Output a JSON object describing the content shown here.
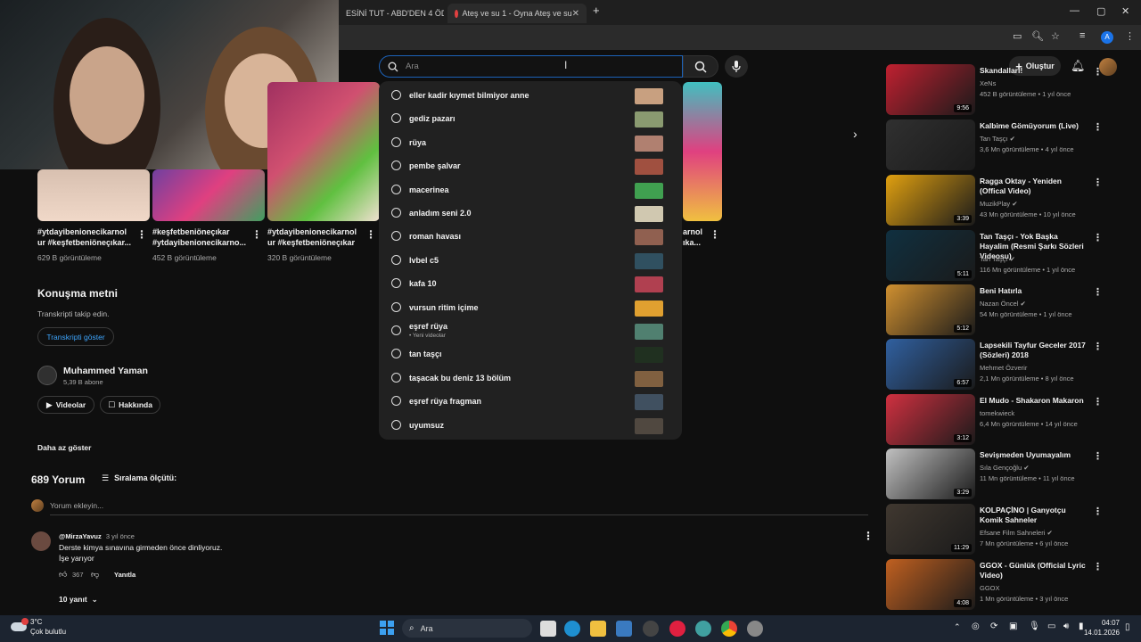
{
  "browser": {
    "tabs": [
      {
        "title": "ESİNİ TUT - ABD'DEN 4 ÖD"
      },
      {
        "title": "Ateş ve su 1 - Oyna Ateş ve su"
      }
    ],
    "new_tab": "+",
    "window_controls": [
      "—",
      "▢",
      "✕"
    ]
  },
  "youtube": {
    "search_placeholder": "Ara",
    "create_label": "Oluştur",
    "suggestions": [
      {
        "text": "eller kadir kıymet bilmiyor anne",
        "color": "#c8a080"
      },
      {
        "text": "gediz pazarı",
        "color": "#8a9a70"
      },
      {
        "text": "rüya",
        "color": "#b08070"
      },
      {
        "text": "pembe şalvar",
        "color": "#a05040"
      },
      {
        "text": "macerinea",
        "color": "#40a050"
      },
      {
        "text": "anladım seni 2.0",
        "color": "#d0c8b0"
      },
      {
        "text": "roman havası",
        "color": "#906050"
      },
      {
        "text": "lvbel c5",
        "color": "#305060"
      },
      {
        "text": "kafa 10",
        "color": "#b04050"
      },
      {
        "text": "vursun ritim içime",
        "color": "#e0a030"
      },
      {
        "text": "eşref rüya",
        "subtext": "• Yeni videolar",
        "color": "#508070"
      },
      {
        "text": "tan taşçı",
        "color": "#203020"
      },
      {
        "text": "taşacak bu deniz 13 bölüm",
        "color": "#806040"
      },
      {
        "text": "eşref rüya fragman",
        "color": "#405060"
      },
      {
        "text": "uyumsuz",
        "color": "#504840"
      }
    ],
    "shorts": [
      {
        "title": "#ytdayibenionecikarnol ur #keşfetbeniöneçıkar...",
        "views": "629 B görüntüleme"
      },
      {
        "title": "#keşfetbeniöneçıkar #ytdayibenionecikarno...",
        "views": "452 B görüntüleme"
      },
      {
        "title": "#ytdayibenionecikarnol ur #keşfetbeniöneçıkar",
        "views": "320 B görüntüleme"
      },
      {
        "title": "...arnol ...ıka...",
        "views": ""
      }
    ],
    "transcript": {
      "heading": "Konuşma metni",
      "sub": "Transkripti takip edin.",
      "button": "Transkripti göster"
    },
    "channel": {
      "name": "Muhammed Yaman",
      "subs": "5,39 B abone",
      "videos_btn": "Videolar",
      "about_btn": "Hakkında"
    },
    "show_less": "Daha az göster",
    "comments": {
      "count": "689 Yorum",
      "sort": "Sıralama ölçütü:",
      "add_placeholder": "Yorum ekleyin...",
      "first": {
        "author": "@MirzaYavuz",
        "time": "3 yıl önce",
        "line1": "Derste kimya sınavına girmeden önce dinliyoruz.",
        "line2": "İşe yarıyor",
        "likes": "367",
        "reply": "Yanıtla",
        "replies": "10 yanıt"
      }
    },
    "sidebar": [
      {
        "title": "Skandalları!",
        "channel": "XeNs",
        "meta": "452 B görüntüleme  •  1 yıl önce",
        "duration": "9:56",
        "color": "#c02030"
      },
      {
        "title": "Kalbime Gömüyorum (Live)",
        "channel": "Tan Taşçı ✔",
        "meta": "3,6 Mn görüntüleme  •  4 yıl önce",
        "duration": "",
        "color": "#303030"
      },
      {
        "title": "Ragga Oktay - Yeniden (Offical Video)",
        "channel": "MuzikPlay ✔",
        "meta": "43 Mn görüntüleme  •  10 yıl önce",
        "duration": "3:39",
        "color": "#e0a010"
      },
      {
        "title": "Tan Taşçı - Yok Başka Hayalim (Resmi Şarkı Sözleri Videosu)",
        "channel": "Tan Taşçı ✔",
        "meta": "116 Mn görüntüleme  •  1 yıl önce",
        "duration": "5:11",
        "color": "#103040"
      },
      {
        "title": "Beni Hatırla",
        "channel": "Nazan Öncel ✔",
        "meta": "54 Mn görüntüleme  •  1 yıl önce",
        "duration": "5:12",
        "color": "#d09030"
      },
      {
        "title": "Lapsekili Tayfur Geceler 2017 (Sözleri) 2018",
        "channel": "Mehmet Özverir",
        "meta": "2,1 Mn görüntüleme  •  8 yıl önce",
        "duration": "6:57",
        "color": "#3060a0"
      },
      {
        "title": "El Mudo - Shakaron Makaron",
        "channel": "tomekwieck",
        "meta": "6,4 Mn görüntüleme  •  14 yıl önce",
        "duration": "3:12",
        "color": "#d03040"
      },
      {
        "title": "Sevişmeden Uyumayalım",
        "channel": "Sıla Gençoğlu ✔",
        "meta": "11 Mn görüntüleme  •  11 yıl önce",
        "duration": "3:29",
        "color": "#c0c0c0"
      },
      {
        "title": "KOLPAÇİNO | Ganyotçu Komik Sahneler",
        "channel": "Efsane Film Sahneleri ✔",
        "meta": "7 Mn görüntüleme  •  6 yıl önce",
        "duration": "11:29",
        "color": "#403830"
      },
      {
        "title": "GGOX - Günlük (Official Lyric Video)",
        "channel": "GGOX",
        "meta": "1 Mn görüntüleme  •  3 yıl önce",
        "duration": "4:08",
        "color": "#c06020"
      }
    ]
  },
  "taskbar": {
    "weather_temp": "3°C",
    "weather_desc": "Çok bulutlu",
    "search": "Ara",
    "time": "04:07",
    "date": "14.01.2026"
  }
}
